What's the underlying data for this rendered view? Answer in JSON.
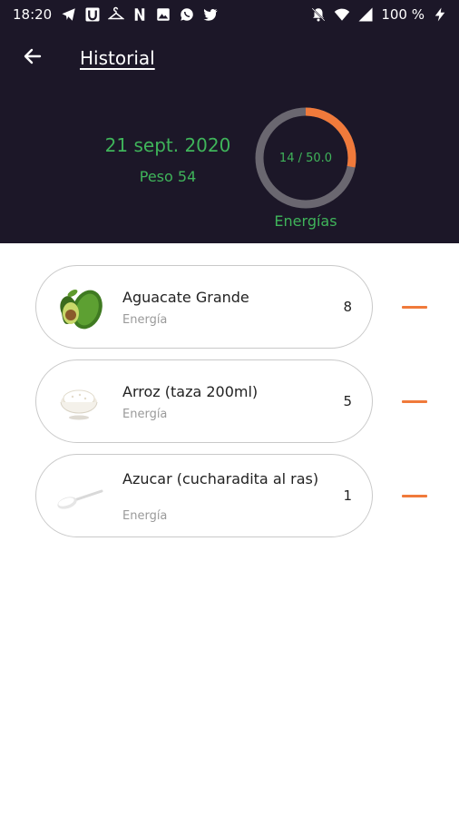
{
  "status_bar": {
    "time": "18:20",
    "battery": "100 %",
    "left_icons": [
      "telegram-icon",
      "u-app-icon",
      "hanger-icon",
      "n-app-icon",
      "image-icon",
      "whatsapp-icon",
      "twitter-icon"
    ],
    "right_icons": [
      "notifications-off-icon",
      "wifi-icon",
      "signal-icon",
      "charging-icon"
    ]
  },
  "appbar": {
    "title": "Historial",
    "back_icon": "arrow-left-icon"
  },
  "summary": {
    "date": "21 sept. 2020",
    "weight": "Peso 54",
    "ring_text": "14 / 50.0",
    "ring_label": "Energías",
    "consumed": 14,
    "target": 50.0
  },
  "foods": [
    {
      "name": "Aguacate Grande",
      "subtitle": "Energía",
      "quantity": "8",
      "image_icon": "avocado-icon"
    },
    {
      "name": "Arroz (taza 200ml)",
      "subtitle": "Energía",
      "quantity": "5",
      "image_icon": "rice-bowl-icon"
    },
    {
      "name": "Azucar (cucharadita al ras)",
      "subtitle": "Energía",
      "quantity": "1",
      "image_icon": "sugar-spoon-icon"
    }
  ],
  "colors": {
    "header_bg": "#1c1728",
    "accent_green": "#3fb45a",
    "accent_orange": "#f07a3b",
    "ring_track": "#6a6770"
  }
}
